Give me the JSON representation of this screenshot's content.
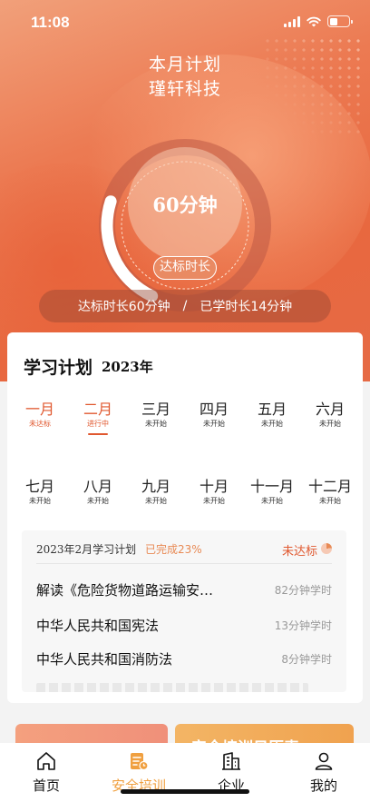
{
  "status_bar": {
    "time": "11:08"
  },
  "hero": {
    "title_line1": "本月计划",
    "title_line2": "瑾轩科技",
    "ring_value": "60分钟",
    "ring_label": "达标时长",
    "progress_fraction": 0.23,
    "summary_target": "达标时长60分钟",
    "summary_sep": "/",
    "summary_learned": "已学时长14分钟"
  },
  "plan_card": {
    "title": "学习计划",
    "year": "2023年",
    "months_row1": [
      {
        "name": "一月",
        "status": "未达标"
      },
      {
        "name": "二月",
        "status": "进行中"
      },
      {
        "name": "三月",
        "status": "未开始"
      },
      {
        "name": "四月",
        "status": "未开始"
      },
      {
        "name": "五月",
        "status": "未开始"
      },
      {
        "name": "六月",
        "status": "未开始"
      }
    ],
    "months_row2": [
      {
        "name": "七月",
        "status": "未开始"
      },
      {
        "name": "八月",
        "status": "未开始"
      },
      {
        "name": "九月",
        "status": "未开始"
      },
      {
        "name": "十月",
        "status": "未开始"
      },
      {
        "name": "十一月",
        "status": "未开始"
      },
      {
        "name": "十二月",
        "status": "未开始"
      }
    ],
    "monthly_plan": {
      "title": "2023年2月学习计划",
      "completed": "已完成23%",
      "status": "未达标",
      "courses": [
        {
          "name": "解读《危险货物道路运输安…",
          "time": "82分钟学时"
        },
        {
          "name": "中华人民共和国宪法",
          "time": "13分钟学时"
        },
        {
          "name": "中华人民共和国消防法",
          "time": "8分钟学时"
        }
      ]
    }
  },
  "teaser": {
    "right_text": "安全培训日历表"
  },
  "tabbar": {
    "items": [
      {
        "label": "首页",
        "icon": "home-icon"
      },
      {
        "label": "安全培训",
        "icon": "training-icon"
      },
      {
        "label": "企业",
        "icon": "building-icon"
      },
      {
        "label": "我的",
        "icon": "person-icon"
      }
    ]
  },
  "colors": {
    "accent": "#e0582f",
    "tab_active": "#f0a040",
    "hero": "#ec7a52"
  }
}
